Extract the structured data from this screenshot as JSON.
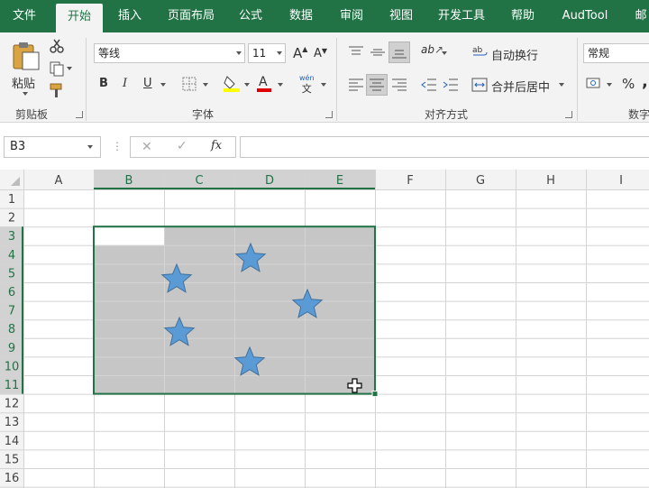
{
  "tabs": [
    {
      "label": "文件",
      "active": false
    },
    {
      "label": "开始",
      "active": true
    },
    {
      "label": "插入",
      "active": false
    },
    {
      "label": "页面布局",
      "active": false
    },
    {
      "label": "公式",
      "active": false
    },
    {
      "label": "数据",
      "active": false
    },
    {
      "label": "审阅",
      "active": false
    },
    {
      "label": "视图",
      "active": false
    },
    {
      "label": "开发工具",
      "active": false
    },
    {
      "label": "帮助",
      "active": false
    },
    {
      "label": "AudTool",
      "active": false
    },
    {
      "label": "邮",
      "active": false
    }
  ],
  "ribbon": {
    "clipboard": {
      "label": "剪贴板",
      "paste": "粘贴"
    },
    "font": {
      "label": "字体",
      "name": "等线",
      "size": "11",
      "bold": "B",
      "italic": "I",
      "underline": "U",
      "grow": "A",
      "shrink": "A",
      "phonetic_top": "wén",
      "phonetic_bottom": "文"
    },
    "alignment": {
      "label": "对齐方式",
      "wrap": "自动换行",
      "merge": "合并后居中",
      "orient_char": "ab"
    },
    "number": {
      "label": "数字",
      "format": "常规",
      "percent": "%",
      "comma": ","
    }
  },
  "formula_bar": {
    "name_box": "B3",
    "cancel": "✕",
    "enter": "✓",
    "fx": "fx",
    "formula": ""
  },
  "sheet": {
    "columns": [
      "A",
      "B",
      "C",
      "D",
      "E",
      "F",
      "G",
      "H",
      "I"
    ],
    "rows": [
      "1",
      "2",
      "3",
      "4",
      "5",
      "6",
      "7",
      "8",
      "9",
      "10",
      "11",
      "12",
      "13",
      "14",
      "15",
      "16"
    ],
    "selected_columns": [
      "B",
      "C",
      "D",
      "E"
    ],
    "selected_rows": [
      "3",
      "4",
      "5",
      "6",
      "7",
      "8",
      "9",
      "10",
      "11"
    ],
    "active_cell": "B3",
    "selection": "B3:E11",
    "selection_fill": "#c6c6c6",
    "grid_color": "#d4d4d4",
    "accent": "#217346",
    "star_color": "#5b9bd5",
    "star_count": 5
  }
}
